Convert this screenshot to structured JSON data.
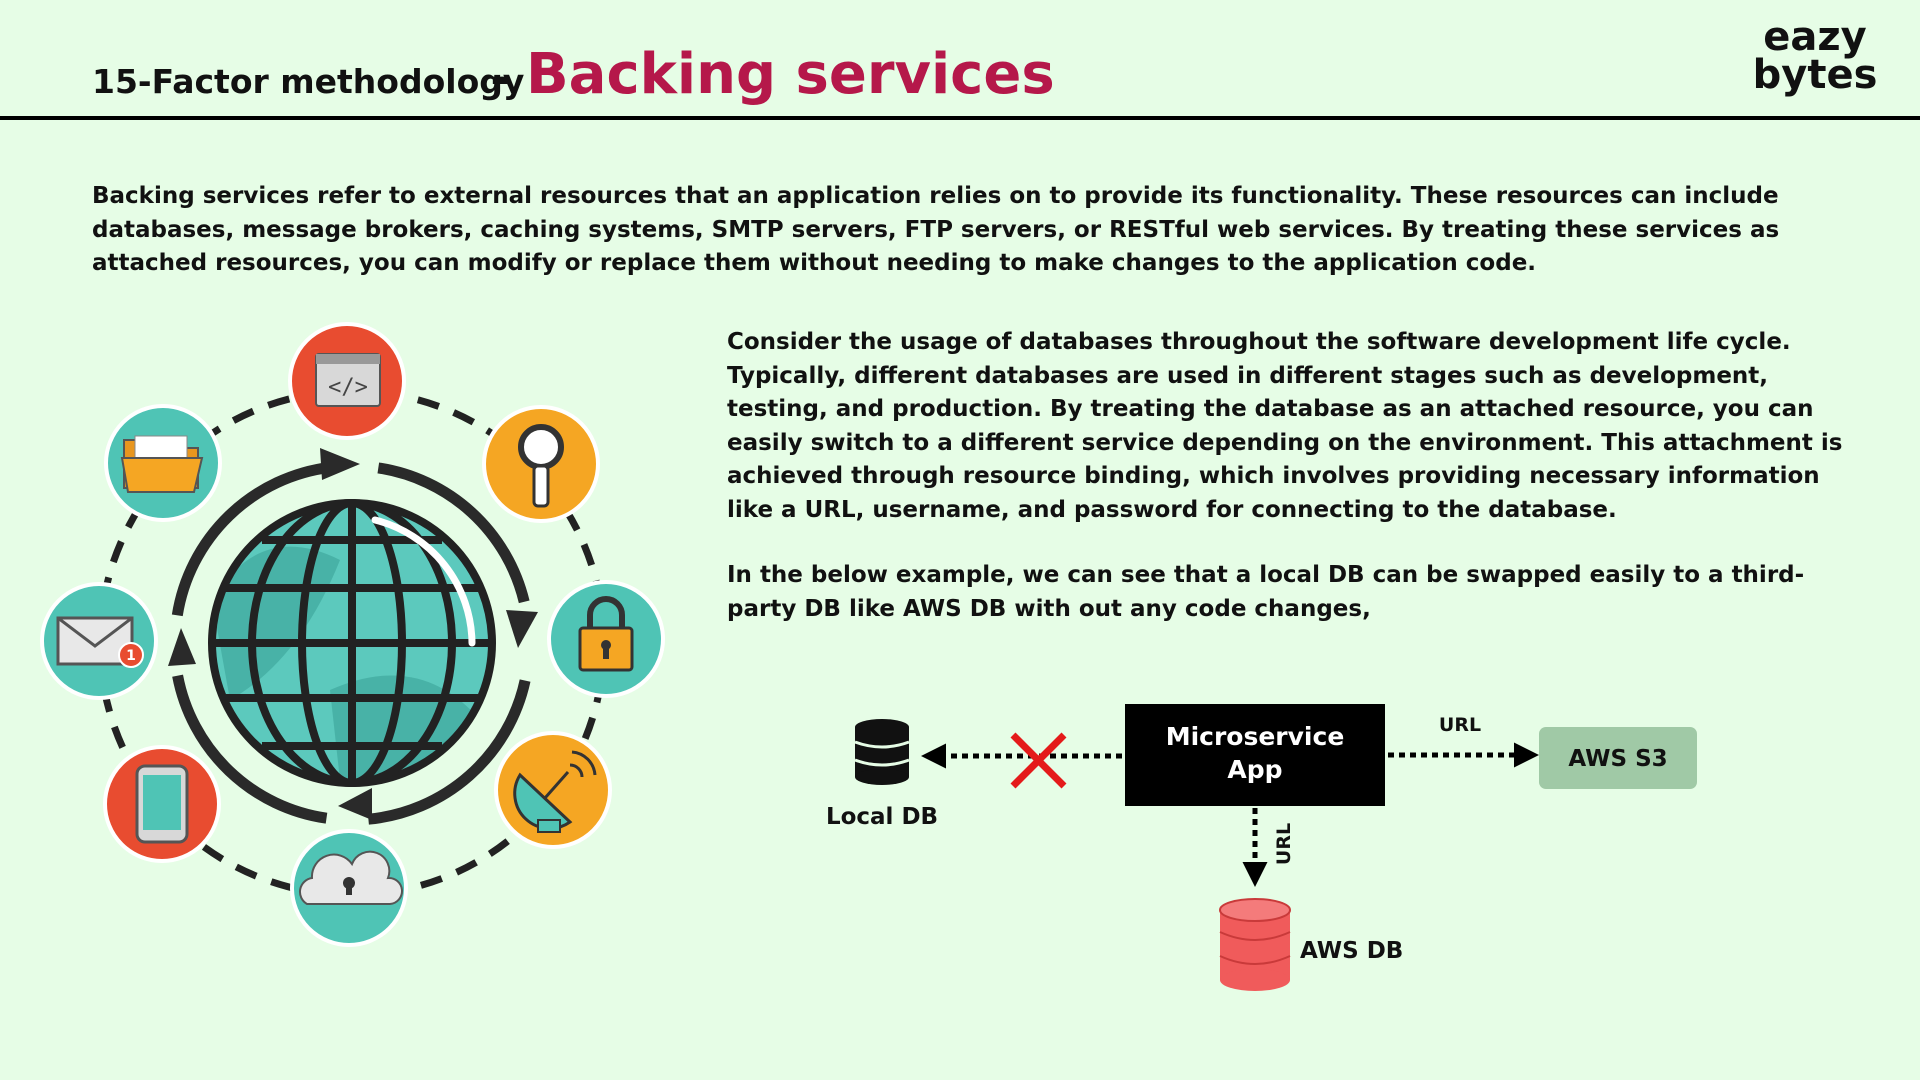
{
  "header": {
    "prefix": "15-Factor methodology",
    "dash": "-",
    "title": "Backing services",
    "logo_line1": "eazy",
    "logo_line2": "bytes"
  },
  "content": {
    "intro": "Backing services refer to external resources that an application relies on to provide its functionality. These resources can include databases, message brokers, caching systems, SMTP servers, FTP servers, or RESTful web services. By treating these services as attached resources, you can modify or replace them without needing to make changes to the application code.",
    "paragraph2": "Consider the usage of databases throughout the software development life cycle. Typically, different databases are used in different stages such as development, testing, and production. By treating the database as an attached resource, you can easily switch to a different service depending on the environment. This attachment is achieved through resource binding, which involves providing necessary information like a URL, username, and password for connecting to the database.",
    "paragraph3": "In the below example, we can see that a local DB can be swapped easily to a third-party DB like AWS DB with out any code changes,"
  },
  "diagram": {
    "app_line1": "Microservice",
    "app_line2": "App",
    "local_db": "Local DB",
    "aws_s3": "AWS S3",
    "aws_db": "AWS DB",
    "url_right": "URL",
    "url_down": "URL",
    "icons": [
      "code-window-icon",
      "magnifier-icon",
      "padlock-icon",
      "satellite-dish-icon",
      "cloud-lock-icon",
      "smartphone-icon",
      "mail-notification-icon",
      "folder-icon"
    ],
    "notification_count": "1"
  },
  "colors": {
    "background": "#e6fde6",
    "title_accent": "#b5184a",
    "teal": "#4fc4b5",
    "red": "#e84c30",
    "orange": "#f5a623",
    "aws_s3_fill": "#a0c9a6",
    "aws_db_fill": "#f05b5b",
    "cross_red": "#e41a1a"
  }
}
